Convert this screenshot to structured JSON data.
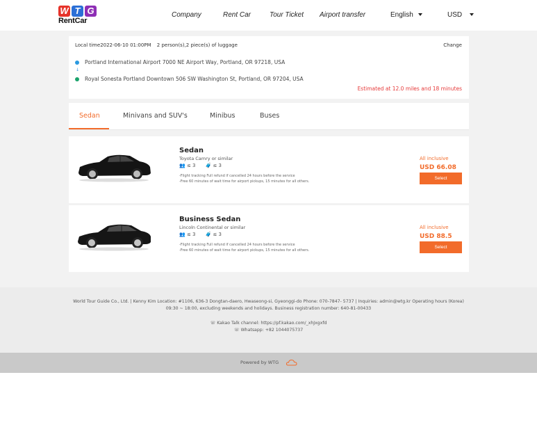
{
  "brand": {
    "letters": [
      "W",
      "T",
      "G"
    ],
    "letter_colors": [
      "#e6332a",
      "#2b6fd6",
      "#8e2fb5"
    ],
    "subtitle": "RentCar"
  },
  "nav": {
    "items": [
      "Company",
      "Rent Car",
      "Tour Ticket",
      "Airport transfer"
    ],
    "language": "English",
    "currency": "USD"
  },
  "trip": {
    "local_time_label": "Local time",
    "local_time": "2022-06-10 01:00PM",
    "passengers": "2 person(s),2 piece(s) of luggage",
    "change_label": "Change",
    "pickup": "Portland International Airport 7000 NE Airport Way, Portland, OR 97218, USA",
    "dropoff": "Royal Sonesta Portland Downtown 506 SW Washington St, Portland, OR 97204, USA",
    "arrow": "↓",
    "estimate": "Estimated at 12.0 miles and 18 minutes",
    "pickup_color": "#2b9ae0",
    "dropoff_color": "#1aa36c"
  },
  "tabs": [
    "Sedan",
    "Minivans and SUV's",
    "Minibus",
    "Buses"
  ],
  "active_tab": "Sedan",
  "vehicles": [
    {
      "name": "Sedan",
      "similar": "Toyota Camry or similar",
      "passengers": "≤ 3",
      "luggage": "≤ 3",
      "note1": "-Flight tracking  Full refund if cancelled 24 hours before the service",
      "note2": "-Free 60 minutes of wait time for airport pickups, 15 minutes for all others.",
      "inclusive": "All inclusive",
      "price": "USD 66.08",
      "select": "Select"
    },
    {
      "name": "Business Sedan",
      "similar": "Lincoln Continental or similar",
      "passengers": "≤ 3",
      "luggage": "≤ 3",
      "note1": "-Flight tracking  Full refund if cancelled 24 hours before the service",
      "note2": "-Free 60 minutes of wait time for airport pickups, 15 minutes for all others.",
      "inclusive": "All inclusive",
      "price": "USD 88.5",
      "select": "Select"
    }
  ],
  "footer": {
    "line1": "World Tour Guide Co., Ltd. | Kenny Kim Location: #1106, 636-3 Dongtan-daero, Hwaseong-si, Gyeonggi-do Phone: 070-7847- 5737 | Inquiries: admin@wtg.kr Operating hours (Korea)",
    "line2": "09:30 ~ 18:00, excluding weekends and holidays. Business registration number: 640-81-00433",
    "kakao": "Kakao Talk channel: https://pf.kakao.com/_xhJxgxfd",
    "whatsapp": "Whatsapp: +82 1044075737",
    "powered": "Powered by WTG"
  },
  "colors": {
    "accent": "#f26b2a",
    "estimate": "#e63a3a"
  }
}
